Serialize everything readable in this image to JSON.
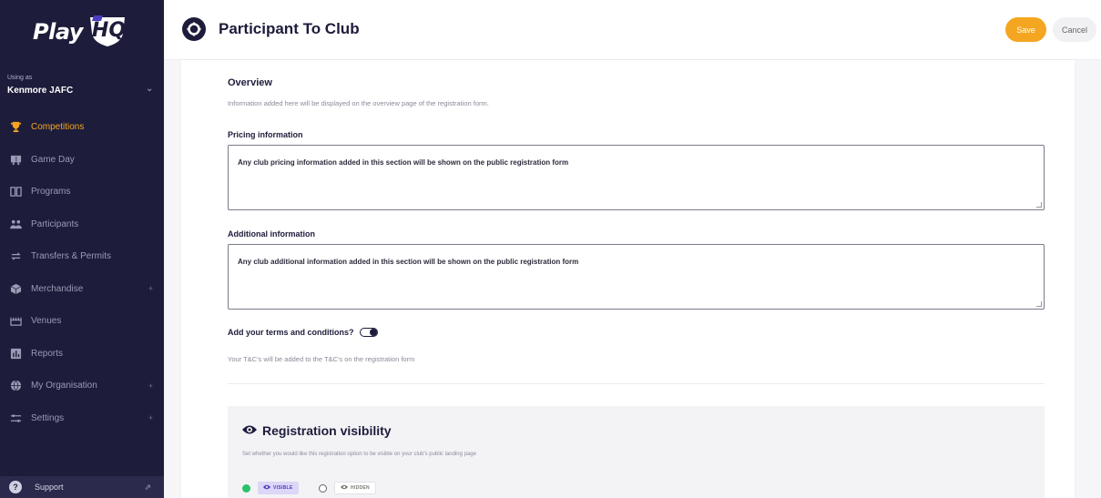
{
  "app": {
    "logo_play": "Play",
    "logo_hq": "HQ"
  },
  "sidebar": {
    "using_as_label": "Using as",
    "org_name": "Kenmore JAFC",
    "items": [
      {
        "label": "Competitions",
        "icon": "trophy-icon",
        "active": true
      },
      {
        "label": "Game Day",
        "icon": "scoreboard-icon"
      },
      {
        "label": "Programs",
        "icon": "book-icon"
      },
      {
        "label": "Participants",
        "icon": "people-icon"
      },
      {
        "label": "Transfers & Permits",
        "icon": "transfer-icon"
      },
      {
        "label": "Merchandise",
        "icon": "box-icon",
        "expandable": true
      },
      {
        "label": "Venues",
        "icon": "stadium-icon"
      },
      {
        "label": "Reports",
        "icon": "chart-icon"
      },
      {
        "label": "My Organisation",
        "icon": "globe-icon",
        "expandable": true
      },
      {
        "label": "Settings",
        "icon": "sliders-icon",
        "expandable": true
      }
    ],
    "support_label": "Support"
  },
  "header": {
    "title": "Participant To Club",
    "save_label": "Save",
    "cancel_label": "Cancel"
  },
  "overview": {
    "title": "Overview",
    "description": "Information added here will be displayed on the overview page of the registration form.",
    "pricing_label": "Pricing information",
    "pricing_value": "Any club pricing information added in this section will be shown on the public registration form",
    "additional_label": "Additional information",
    "additional_value": "Any club additional information added in this section will be shown on the public registration form",
    "terms_label": "Add your terms and conditions?",
    "terms_enabled": false,
    "terms_description": "Your T&C's will be added to the T&C's on the registration form"
  },
  "visibility": {
    "title": "Registration visibility",
    "description": "Set whether you would like this registration option to be visible on your club's public landing page",
    "options": [
      {
        "label": "VISIBLE",
        "selected": true
      },
      {
        "label": "HIDDEN",
        "selected": false
      }
    ]
  },
  "colors": {
    "sidebar_bg": "#1d1c3b",
    "accent": "#f4a620",
    "visible_green": "#27c36b"
  }
}
